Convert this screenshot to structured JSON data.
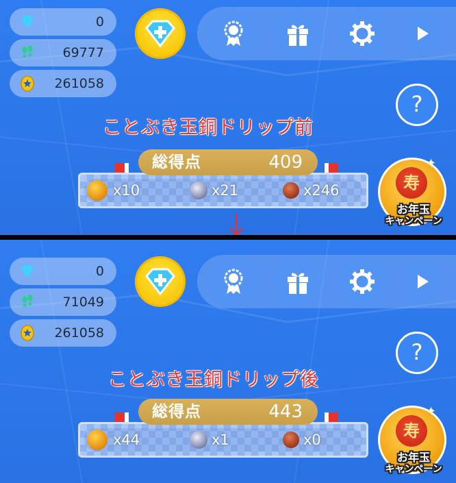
{
  "panels": {
    "before": {
      "stats": {
        "gems": "0",
        "steps": "69777",
        "coins": "261058"
      },
      "caption": "ことぶき玉銅ドリップ前",
      "score_label": "総得点",
      "score": "409",
      "items": {
        "gold": "x10",
        "silver": "x21",
        "bronze": "x246"
      }
    },
    "after": {
      "stats": {
        "gems": "0",
        "steps": "71049",
        "coins": "261058"
      },
      "caption": "ことぶき玉銅ドリップ後",
      "score_label": "総得点",
      "score": "443",
      "items": {
        "gold": "x44",
        "silver": "x1",
        "bronze": "x0"
      }
    }
  },
  "common": {
    "help_label": "?",
    "campaign_seal": "寿",
    "campaign_line1": "お年玉",
    "campaign_line2": "キャンペーン"
  },
  "icons": [
    "gem-icon",
    "footprints-icon",
    "coin-icon",
    "gem-plus-icon",
    "medal-icon",
    "gift-icon",
    "gear-icon",
    "play-icon",
    "help-icon",
    "down-arrow-icon"
  ],
  "colors": {
    "background": "#2f7df0",
    "caption": "#e53232",
    "score_bar": "#d1aa52",
    "gold_button": "#f8c80c"
  }
}
